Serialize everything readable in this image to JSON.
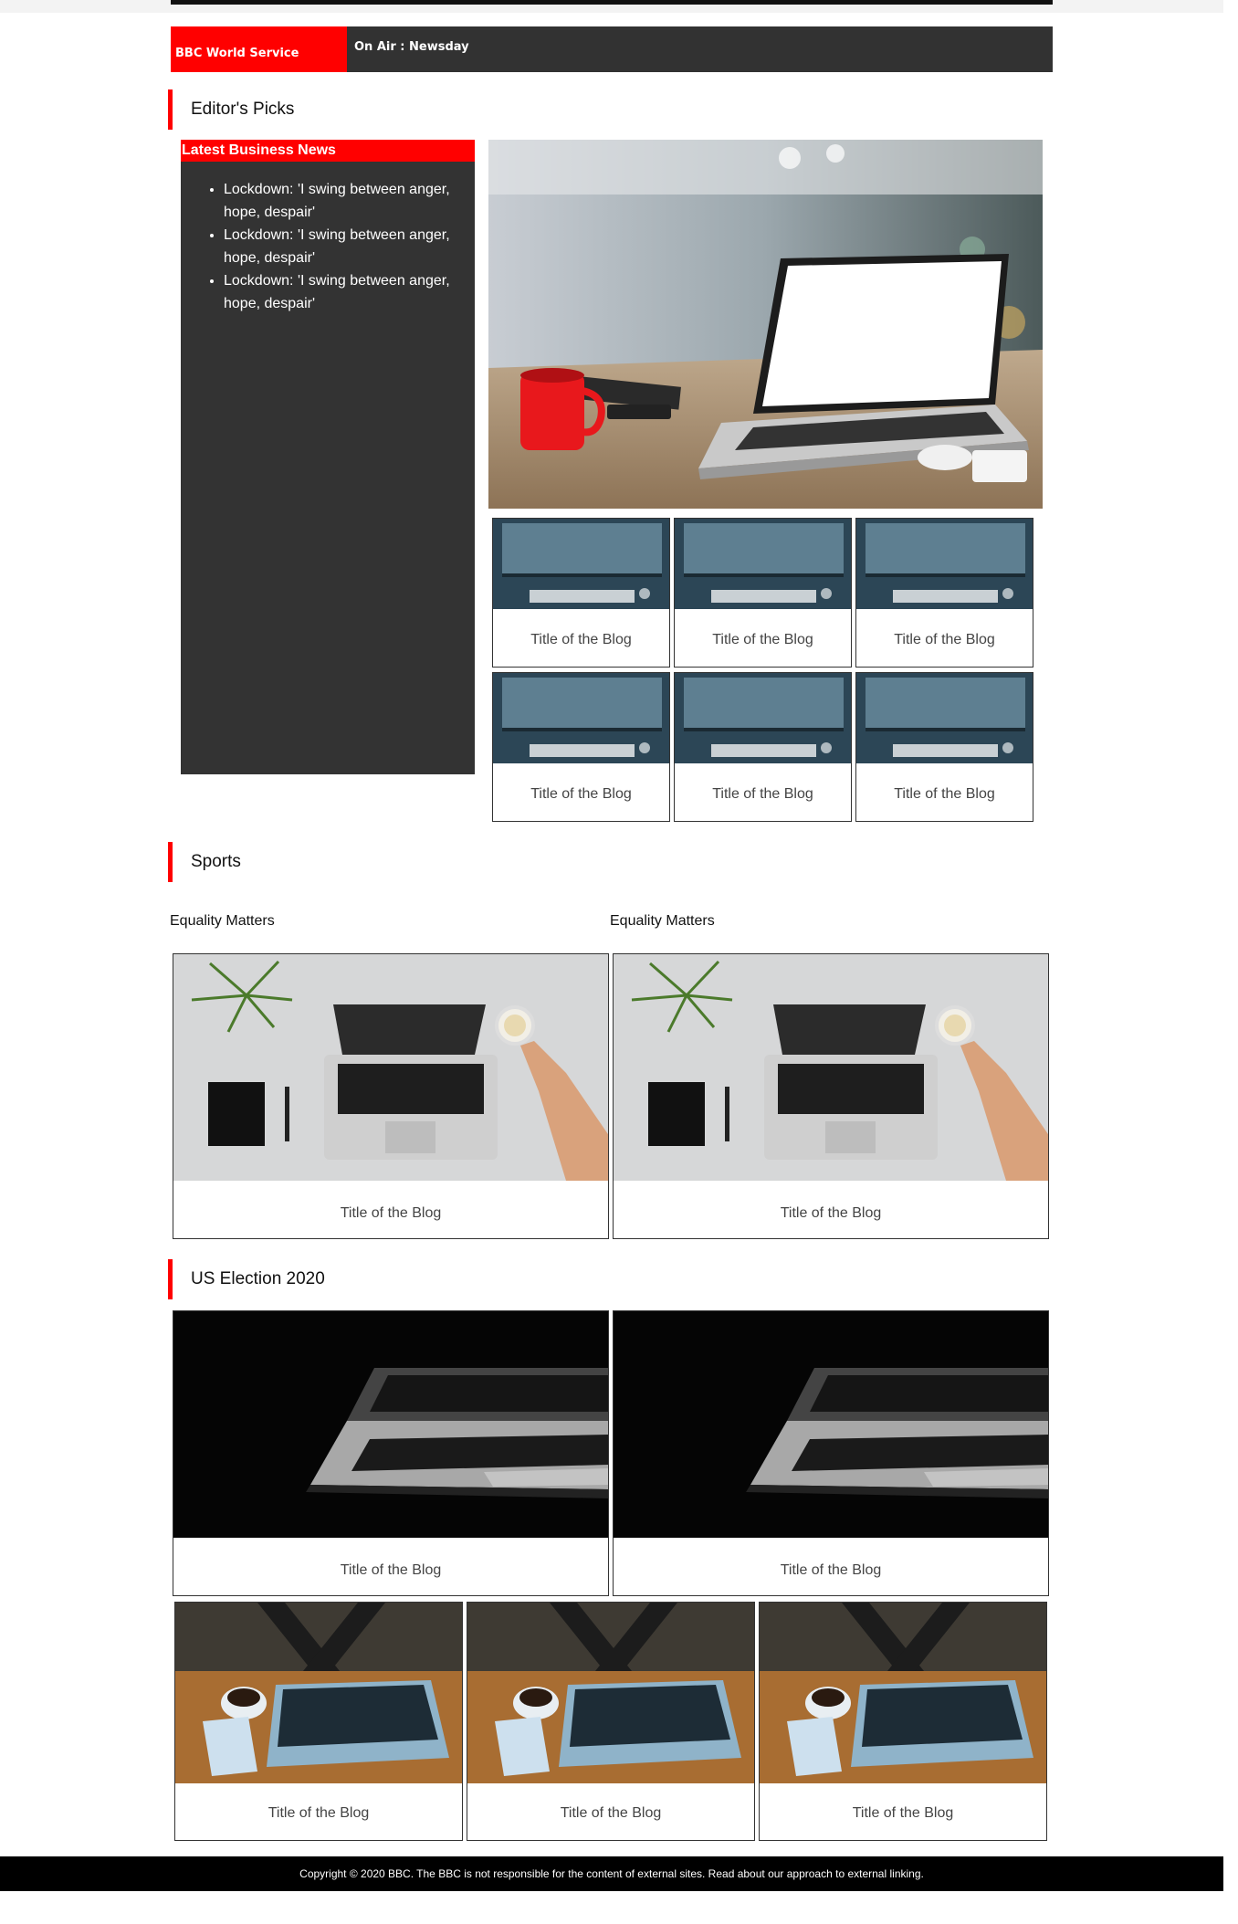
{
  "live": {
    "service": "BBC World Service",
    "on_air": "On Air : Newsday"
  },
  "editors_picks": {
    "heading": "Editor's Picks",
    "latest": {
      "heading": "Latest Business News",
      "items": [
        "Lockdown: 'I swing between anger, hope, despair'",
        "Lockdown: 'I swing between anger, hope, despair'",
        "Lockdown: 'I swing between anger, hope, despair'"
      ]
    },
    "cards": [
      "Title of the Blog",
      "Title of the Blog",
      "Title of the Blog",
      "Title of the Blog",
      "Title of the Blog",
      "Title of the Blog"
    ]
  },
  "sports": {
    "heading": "Sports",
    "columns": [
      {
        "label": "Equality Matters",
        "card_title": "Title of the Blog"
      },
      {
        "label": "Equality Matters",
        "card_title": "Title of the Blog"
      }
    ]
  },
  "election": {
    "heading": "US Election 2020",
    "big_cards": [
      "Title of the Blog",
      "Title of the Blog"
    ],
    "small_cards": [
      "Title of the Blog",
      "Title of the Blog",
      "Title of the Blog"
    ]
  },
  "footer": {
    "text": "Copyright © 2020 BBC. The BBC is not responsible for the content of external sites. Read about our approach to external linking."
  },
  "colors": {
    "accent": "#ff0000",
    "dark": "#333333"
  }
}
